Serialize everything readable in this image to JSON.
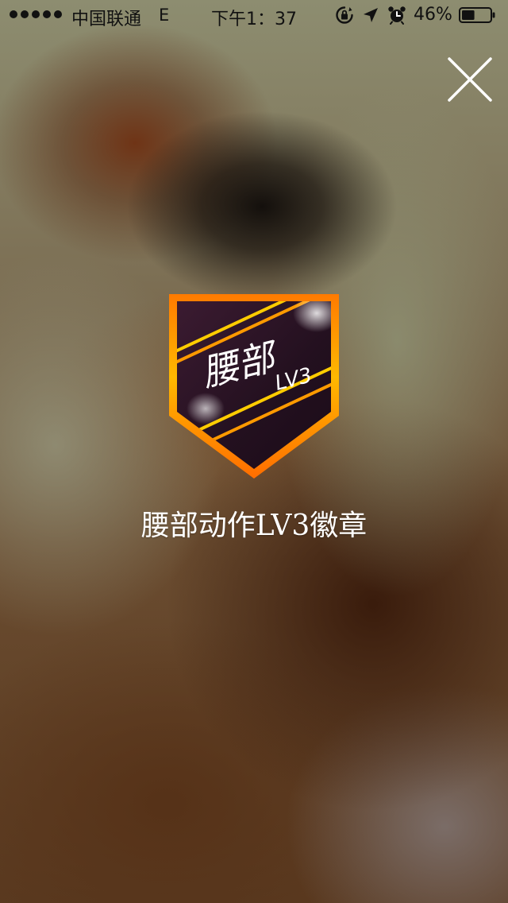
{
  "status_bar": {
    "signal_dots": 5,
    "carrier": "中国联通",
    "network": "E",
    "time": "下午1：37",
    "battery_percent": "46%",
    "battery_level": 0.46
  },
  "badge": {
    "text_main": "腰部",
    "text_level": "LV3",
    "title": "腰部动作LV3徽章"
  },
  "colors": {
    "badge_border": "#ff9a00",
    "badge_inner": "#2a1224",
    "stripe": "#ffd400"
  }
}
